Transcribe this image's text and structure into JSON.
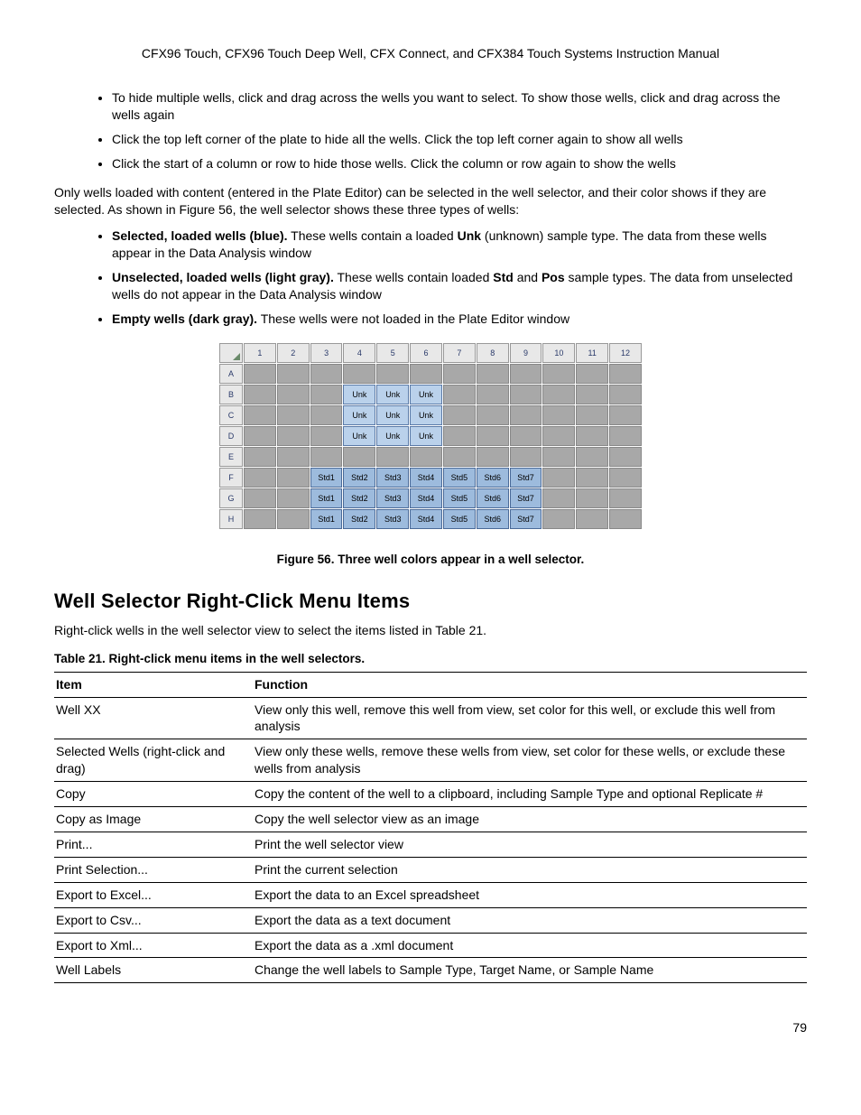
{
  "header": "CFX96 Touch, CFX96 Touch Deep Well, CFX Connect, and CFX384 Touch Systems Instruction Manual",
  "bullets1": [
    "To hide multiple wells, click and drag across the wells you want to select. To show those wells, click and drag across the wells again",
    "Click the top left corner of the plate to hide all the wells. Click the top left corner again to show all wells",
    "Click the start of a column or row to hide those wells. Click the column or row again to show the wells"
  ],
  "para1": "Only wells loaded with content (entered in the Plate Editor) can be selected in the well selector, and their color shows if they are selected. As shown in Figure 56, the well selector shows these three types of wells:",
  "bullets2": [
    {
      "lead": "Selected, loaded wells (blue).",
      "rest_a": " These wells contain a loaded ",
      "bold": "Unk",
      "rest_b": " (unknown) sample type. The data from these wells appear in the Data Analysis window"
    },
    {
      "lead": "Unselected, loaded wells (light gray).",
      "rest_a": " These wells contain loaded ",
      "bold": "Std",
      "rest_b": " and ",
      "bold2": "Pos",
      "rest_c": " sample types. The data from unselected wells do not appear in the Data Analysis window"
    },
    {
      "lead": "Empty wells (dark gray).",
      "rest_a": " These wells were not loaded in the Plate Editor window",
      "bold": "",
      "rest_b": ""
    }
  ],
  "well_plate": {
    "columns": [
      "1",
      "2",
      "3",
      "4",
      "5",
      "6",
      "7",
      "8",
      "9",
      "10",
      "11",
      "12"
    ],
    "rows": [
      "A",
      "B",
      "C",
      "D",
      "E",
      "F",
      "G",
      "H"
    ],
    "cells": {
      "B4": "Unk",
      "B5": "Unk",
      "B6": "Unk",
      "C4": "Unk",
      "C5": "Unk",
      "C6": "Unk",
      "D4": "Unk",
      "D5": "Unk",
      "D6": "Unk",
      "F3": "Std1",
      "F4": "Std2",
      "F5": "Std3",
      "F6": "Std4",
      "F7": "Std5",
      "F8": "Std6",
      "F9": "Std7",
      "G3": "Std1",
      "G4": "Std2",
      "G5": "Std3",
      "G6": "Std4",
      "G7": "Std5",
      "G8": "Std6",
      "G9": "Std7",
      "H3": "Std1",
      "H4": "Std2",
      "H5": "Std3",
      "H6": "Std4",
      "H7": "Std5",
      "H8": "Std6",
      "H9": "Std7"
    }
  },
  "fig_caption": "Figure 56. Three well colors appear in a well selector.",
  "section_heading": "Well Selector Right-Click Menu Items",
  "para2": "Right-click wells in the well selector view to select the items listed in Table 21.",
  "table_caption": "Table 21. Right-click menu items in the well selectors.",
  "menu_table": {
    "head": {
      "item": "Item",
      "function": "Function"
    },
    "rows": [
      {
        "item": "Well XX",
        "function": "View only this well, remove this well from view, set color for this well, or exclude this well from analysis"
      },
      {
        "item": "Selected Wells (right-click and drag)",
        "function": "View only these wells, remove these wells from view, set color for these wells, or exclude these wells from analysis"
      },
      {
        "item": "Copy",
        "function": "Copy the content of the well to a clipboard, including Sample Type and optional Replicate #"
      },
      {
        "item": "Copy as Image",
        "function": "Copy the well selector view as an image"
      },
      {
        "item": "Print...",
        "function": "Print the well selector view"
      },
      {
        "item": "Print Selection...",
        "function": "Print the current selection"
      },
      {
        "item": "Export to Excel...",
        "function": "Export the data to an Excel spreadsheet"
      },
      {
        "item": "Export to Csv...",
        "function": "Export the data as a text document"
      },
      {
        "item": "Export to Xml...",
        "function": "Export the data as a .xml document"
      },
      {
        "item": "Well Labels",
        "function": "Change the well labels to Sample Type, Target Name, or Sample Name"
      }
    ]
  },
  "page_number": "79"
}
